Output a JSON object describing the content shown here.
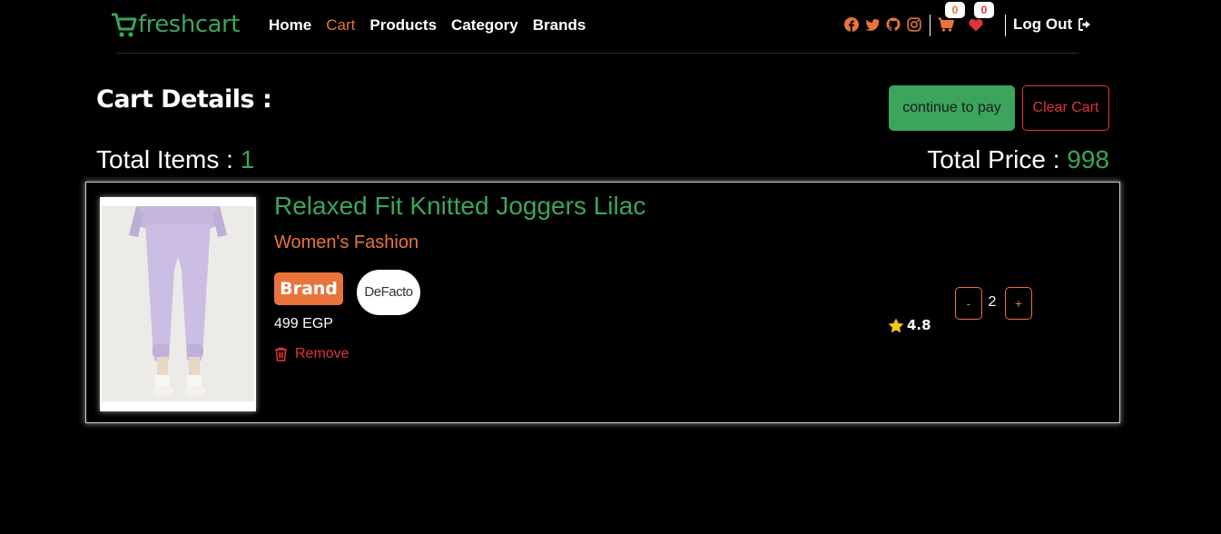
{
  "colors": {
    "accent_green": "#3ba55c",
    "accent_orange": "#e8743b",
    "danger_red": "#e0343a",
    "background": "#000000"
  },
  "brand": {
    "name": "freshcart",
    "icon": "cart-logo-icon"
  },
  "nav": {
    "links": [
      {
        "label": "Home",
        "active": false
      },
      {
        "label": "Cart",
        "active": true
      },
      {
        "label": "Products",
        "active": false
      },
      {
        "label": "Category",
        "active": false
      },
      {
        "label": "Brands",
        "active": false
      }
    ],
    "socials": [
      "facebook-icon",
      "twitter-icon",
      "github-icon",
      "instagram-icon"
    ],
    "cart_count": "0",
    "wishlist_count": "0",
    "logout_label": "Log Out"
  },
  "header": {
    "title": "Cart Details :",
    "pay_label": "continue to pay",
    "clear_label": "Clear Cart",
    "total_items_label": "Total Items :",
    "total_items_value": "1",
    "total_price_label": "Total Price :",
    "total_price_value": "998"
  },
  "item": {
    "name": "Relaxed Fit Knitted Joggers Lilac",
    "category": "Women's Fashion",
    "brand_tag": "Brand",
    "brand_name": "DeFacto",
    "price": "499 EGP",
    "remove_label": "Remove",
    "rating": "4.8",
    "decrement_label": "-",
    "quantity": "2",
    "increment_label": "+"
  }
}
